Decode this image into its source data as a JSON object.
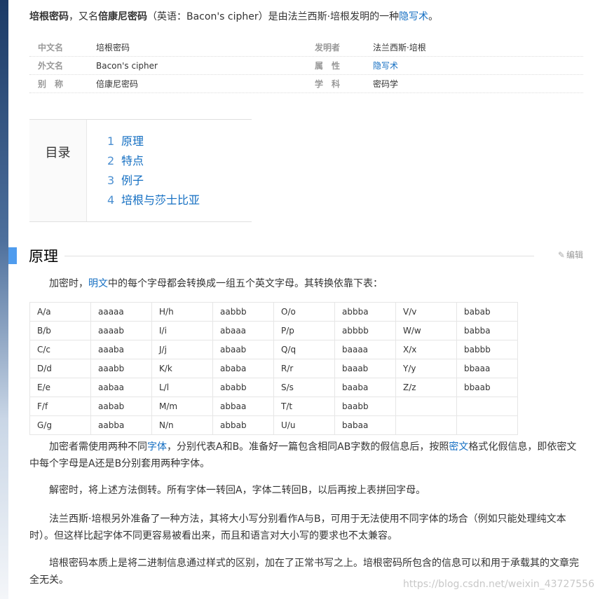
{
  "intro": {
    "term_bold": "培根密码",
    "sep1": "，又名",
    "alias_bold": "倍康尼密码",
    "rest1": "（英语：Bacon's cipher）是由法兰西斯·培根发明的一种",
    "link": "隐写术",
    "end": "。"
  },
  "infobox": [
    {
      "name": "中文名",
      "value": "培根密码",
      "name2": "发明者",
      "value2": "法兰西斯·培根",
      "link2": false
    },
    {
      "name": "外文名",
      "value": "Bacon's cipher",
      "name2": "属　性",
      "value2": "隐写术",
      "link2": true
    },
    {
      "name": "别　称",
      "value": "倍康尼密码",
      "name2": "学　科",
      "value2": "密码学",
      "link2": false
    }
  ],
  "toc": {
    "title": "目录",
    "items": [
      {
        "num": "1",
        "label": "原理"
      },
      {
        "num": "2",
        "label": "特点"
      },
      {
        "num": "3",
        "label": "例子"
      },
      {
        "num": "4",
        "label": "培根与莎士比亚"
      }
    ]
  },
  "section": {
    "title": "原理",
    "edit": "编辑"
  },
  "p1": {
    "a": "加密时，",
    "link": "明文",
    "b": "中的每个字母都会转换成一组五个英文字母。其转换依靠下表："
  },
  "table": [
    [
      "A/a",
      "aaaaa",
      "H/h",
      "aabbb",
      "O/o",
      "abbba",
      "V/v",
      "babab"
    ],
    [
      "B/b",
      "aaaab",
      "I/i",
      "abaaa",
      "P/p",
      "abbbb",
      "W/w",
      "babba"
    ],
    [
      "C/c",
      "aaaba",
      "J/j",
      "abaab",
      "Q/q",
      "baaaa",
      "X/x",
      "babbb"
    ],
    [
      "D/d",
      "aaabb",
      "K/k",
      "ababa",
      "R/r",
      "baaab",
      "Y/y",
      "bbaaa"
    ],
    [
      "E/e",
      "aabaa",
      "L/l",
      "ababb",
      "S/s",
      "baaba",
      "Z/z",
      "bbaab"
    ],
    [
      "F/f",
      "aabab",
      "M/m",
      "abbaa",
      "T/t",
      "baabb",
      "",
      ""
    ],
    [
      "G/g",
      "aabba",
      "N/n",
      "abbab",
      "U/u",
      "babaa",
      "",
      ""
    ]
  ],
  "p2": {
    "a": "加密者需使用两种不同",
    "link1": "字体",
    "b": "，分别代表A和B。准备好一篇包含相同AB字数的假信息后，按照",
    "link2": "密文",
    "c": "格式化假信息，即依密文中每个字母是A还是B分别套用两种字体。"
  },
  "p3": "解密时，将上述方法倒转。所有字体一转回A，字体二转回B，以后再按上表拼回字母。",
  "p4": "法兰西斯·培根另外准备了一种方法，其将大小写分别看作A与B，可用于无法使用不同字体的场合（例如只能处理纯文本时）。但这样比起字体不同更容易被看出来，而且和语言对大小写的要求也不太兼容。",
  "p5": "培根密码本质上是将二进制信息通过样式的区别，加在了正常书写之上。培根密码所包含的信息可以和用于承载其的文章完全无关。",
  "watermark": "https://blog.csdn.net/weixin_43727556"
}
